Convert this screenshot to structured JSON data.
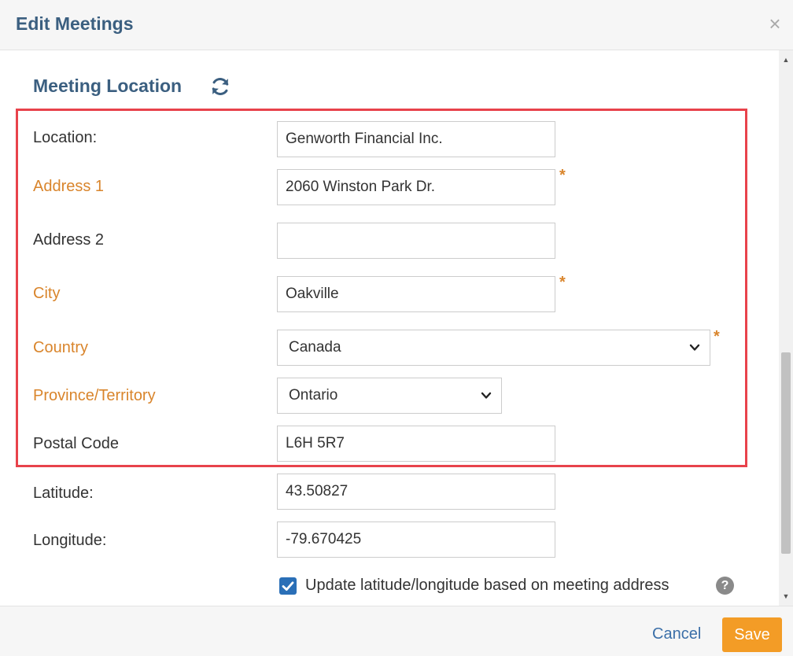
{
  "dialog": {
    "title": "Edit Meetings",
    "close_label": "×"
  },
  "section": {
    "title": "Meeting Location",
    "refresh_icon": "refresh-icon"
  },
  "fields": {
    "location": {
      "label": "Location:",
      "value": "Genworth Financial Inc."
    },
    "address1": {
      "label": "Address 1",
      "value": "2060 Winston Park Dr.",
      "required": "*"
    },
    "address2": {
      "label": "Address 2",
      "value": ""
    },
    "city": {
      "label": "City",
      "value": "Oakville",
      "required": "*"
    },
    "country": {
      "label": "Country",
      "selected": "Canada",
      "required": "*"
    },
    "province": {
      "label": "Province/Territory",
      "selected": "Ontario"
    },
    "postal_code": {
      "label": "Postal Code",
      "value": "L6H 5R7"
    },
    "latitude": {
      "label": "Latitude:",
      "value": "43.50827"
    },
    "longitude": {
      "label": "Longitude:",
      "value": "-79.670425"
    }
  },
  "update_latlng": {
    "label": "Update latitude/longitude based on meeting address",
    "help": "?"
  },
  "footer": {
    "cancel_label": "Cancel",
    "save_label": "Save"
  },
  "colors": {
    "title": "#3b5f80",
    "required": "#d9852c",
    "highlight": "#e8424b",
    "save": "#f39c26",
    "checkbox": "#2a6fb7"
  }
}
